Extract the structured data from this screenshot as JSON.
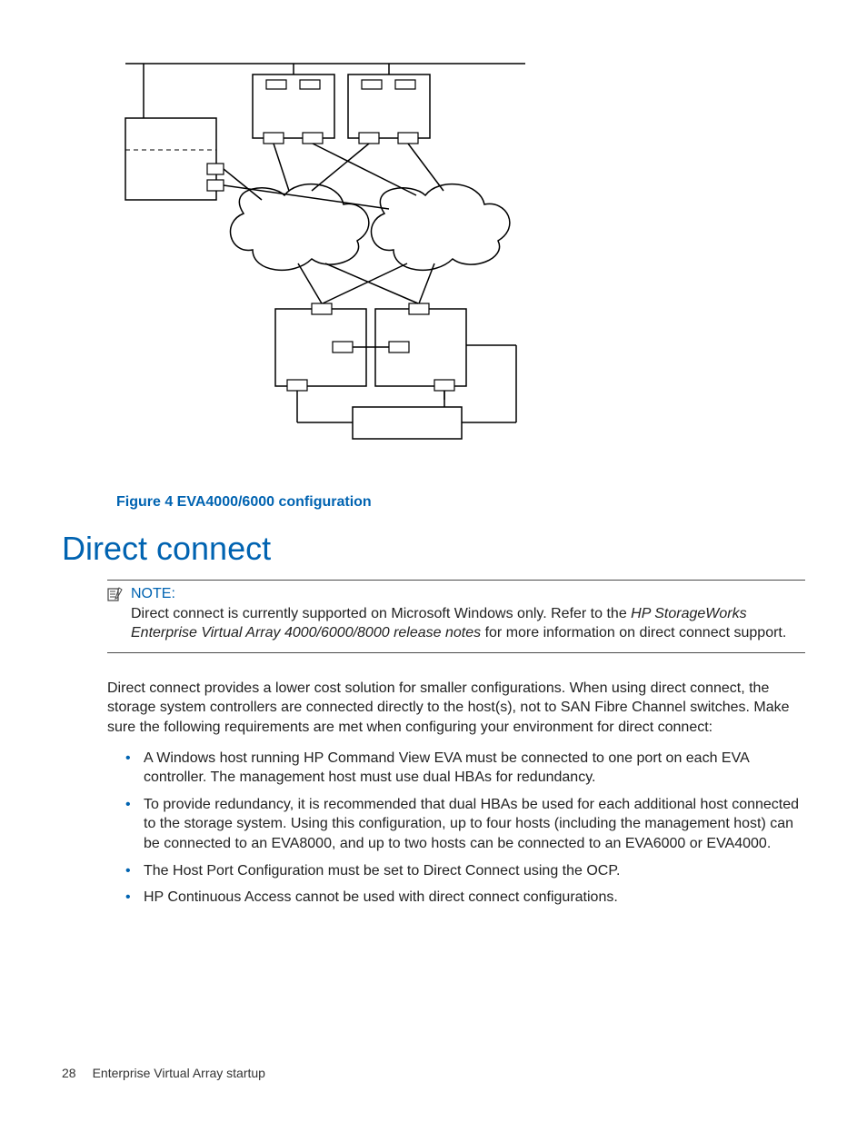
{
  "figure": {
    "caption": "Figure 4 EVA4000/6000 configuration"
  },
  "heading": "Direct connect",
  "note": {
    "title": "NOTE:",
    "body_prefix": "Direct connect is currently supported on Microsoft Windows only.  Refer to the ",
    "body_italic": "HP StorageWorks Enterprise Virtual Array 4000/6000/8000 release notes",
    "body_suffix": " for more information on direct connect support."
  },
  "paragraph": "Direct connect provides a lower cost solution for smaller configurations.  When using direct connect, the storage system controllers are connected directly to the host(s), not to SAN Fibre Channel switches.  Make sure the following requirements are met when configuring your environment for direct connect:",
  "bullets": [
    "A Windows host running HP Command View EVA must be connected to one port on each EVA controller.  The management host must use dual HBAs for redundancy.",
    "To provide redundancy, it is recommended that dual HBAs be used for each additional host connected to the storage system.  Using this configuration, up to four hosts (including the management host) can be connected to an EVA8000, and up to two hosts can be connected to an EVA6000 or EVA4000.",
    "The Host Port Configuration must be set to Direct Connect using the OCP.",
    "HP Continuous Access cannot be used with direct connect configurations."
  ],
  "footer": {
    "page_number": "28",
    "section": "Enterprise Virtual Array startup"
  }
}
